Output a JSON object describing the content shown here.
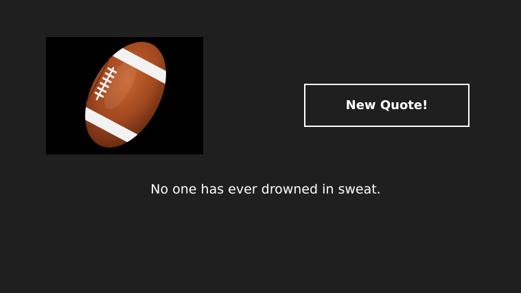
{
  "app": {
    "image": {
      "subject": "american-football",
      "background_color": "#000000",
      "ball_color": "#a0481f",
      "stripe_color": "#f2f2f2"
    },
    "new_quote_button": {
      "label": "New Quote!"
    },
    "quote": {
      "text": "No one has ever drowned in sweat."
    },
    "colors": {
      "background": "#1f1f1f",
      "text": "#ffffff",
      "button_border": "#ffffff"
    }
  }
}
